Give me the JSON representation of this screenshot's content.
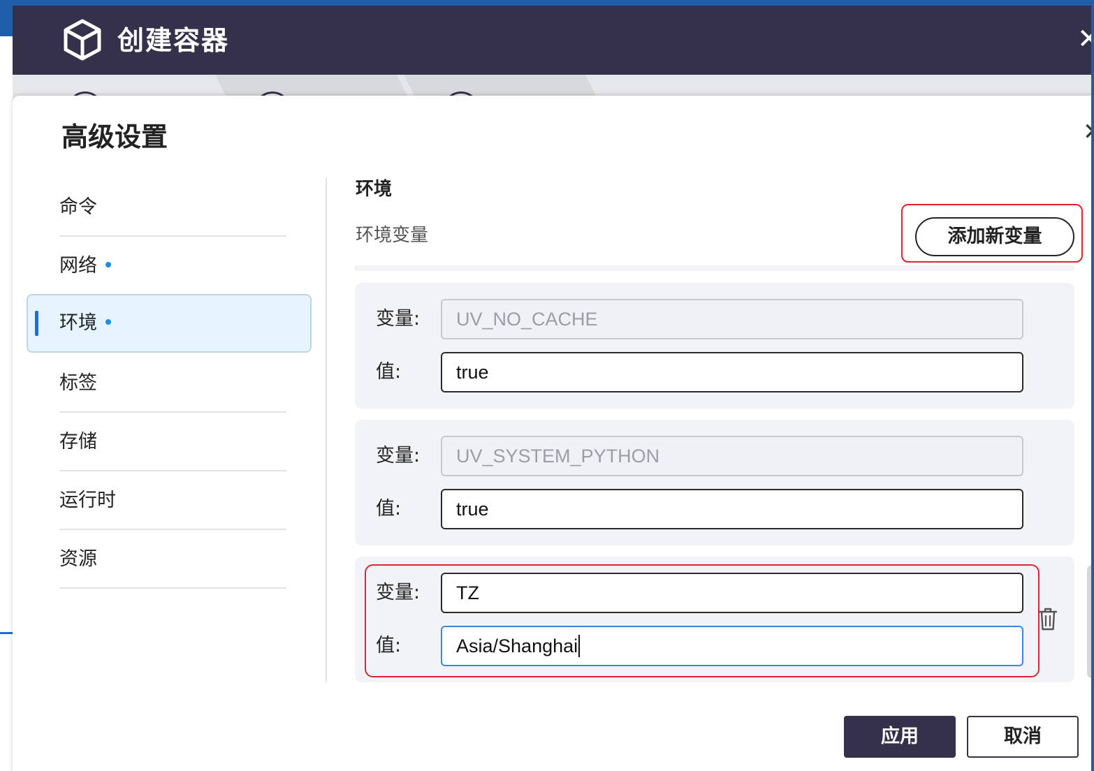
{
  "wizard": {
    "title": "创建容器",
    "icon": "cube-icon",
    "close_icon": "close-icon"
  },
  "modal": {
    "title": "高级设置",
    "close_icon": "close-icon"
  },
  "nav": {
    "items": [
      {
        "label": "命令",
        "dot": false,
        "active": false
      },
      {
        "label": "网络",
        "dot": true,
        "active": false
      },
      {
        "label": "环境",
        "dot": true,
        "active": true
      },
      {
        "label": "标签",
        "dot": false,
        "active": false
      },
      {
        "label": "存储",
        "dot": false,
        "active": false
      },
      {
        "label": "运行时",
        "dot": false,
        "active": false
      },
      {
        "label": "资源",
        "dot": false,
        "active": false
      }
    ]
  },
  "env": {
    "section_title": "环境",
    "subtitle": "环境变量",
    "add_button": "添加新变量",
    "var_label": "变量:",
    "value_label": "值:",
    "rows": [
      {
        "name": "UV_NO_CACHE",
        "value": "true",
        "name_editable": false,
        "deletable": false
      },
      {
        "name": "UV_SYSTEM_PYTHON",
        "value": "true",
        "name_editable": false,
        "deletable": false
      },
      {
        "name": "TZ",
        "value": "Asia/Shanghai",
        "name_editable": true,
        "deletable": true
      }
    ],
    "delete_icon": "trash-icon"
  },
  "footer": {
    "apply": "应用",
    "cancel": "取消"
  },
  "colors": {
    "header_bg": "#35314a",
    "accent_blue": "#1a8fe3",
    "highlight_red": "#e0242f",
    "active_nav_bg": "#e6f5fd"
  }
}
